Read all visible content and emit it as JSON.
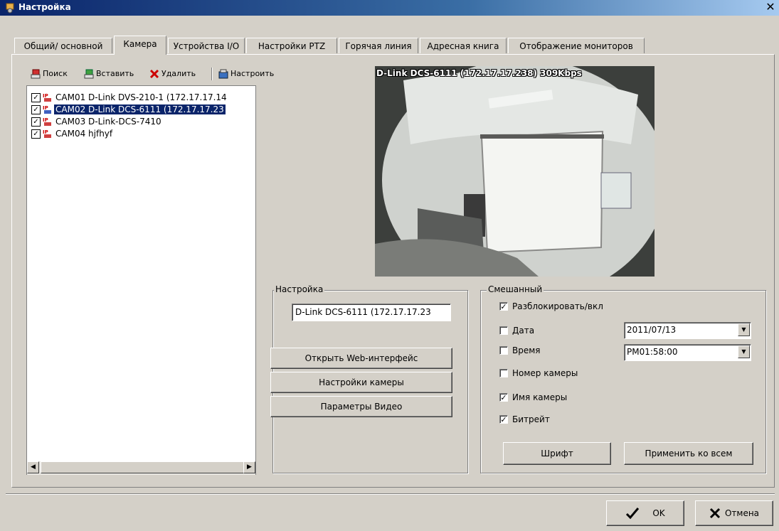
{
  "window": {
    "title": "Настройка",
    "close_glyph": "✕"
  },
  "tabs": [
    {
      "label": "Общий/ основной"
    },
    {
      "label": "Камера"
    },
    {
      "label": "Устройства I/O"
    },
    {
      "label": "Настройки PTZ"
    },
    {
      "label": "Горячая линия"
    },
    {
      "label": "Адресная книга"
    },
    {
      "label": "Отображение мониторов"
    }
  ],
  "active_tab": "Камера",
  "toolbar": {
    "search_label": "Поиск",
    "insert_label": "Вставить",
    "delete_label": "Удалить",
    "configure_label": "Настроить"
  },
  "camera_list": {
    "items": [
      {
        "label": "CAM01 D-Link DVS-210-1 (172.17.17.14",
        "checked": true,
        "selected": false
      },
      {
        "label": "CAM02 D-Link DCS-6111 (172.17.17.23",
        "checked": true,
        "selected": true
      },
      {
        "label": "CAM03 D-Link-DCS-7410",
        "checked": true,
        "selected": false
      },
      {
        "label": "CAM04 hjfhyf",
        "checked": true,
        "selected": false
      }
    ]
  },
  "video": {
    "osd_text": "D-Link DCS-6111 (172.17.17.238) 309Kbps"
  },
  "settings_group": {
    "title": "Настройка",
    "name_value": "D-Link DCS-6111 (172.17.17.23",
    "open_web_label": "Открыть Web-интерфейс",
    "camera_settings_label": "Настройки камеры",
    "video_params_label": "Параметры Видео"
  },
  "mixed_group": {
    "title": "Смешанный",
    "enable_label": "Разблокировать/вкл",
    "enable_checked": true,
    "date_label": "Дата",
    "date_checked": false,
    "date_value": "2011/07/13",
    "time_label": "Время",
    "time_checked": false,
    "time_value": "PM01:58:00",
    "camnum_label": "Номер камеры",
    "camnum_checked": false,
    "camname_label": "Имя камеры",
    "camname_checked": true,
    "bitrate_label": "Битрейт",
    "bitrate_checked": true,
    "font_label": "Шрифт",
    "apply_all_label": "Применить ко всем"
  },
  "footer": {
    "ok_label": "OK",
    "cancel_label": "Отмена"
  },
  "check_glyph": "✓"
}
